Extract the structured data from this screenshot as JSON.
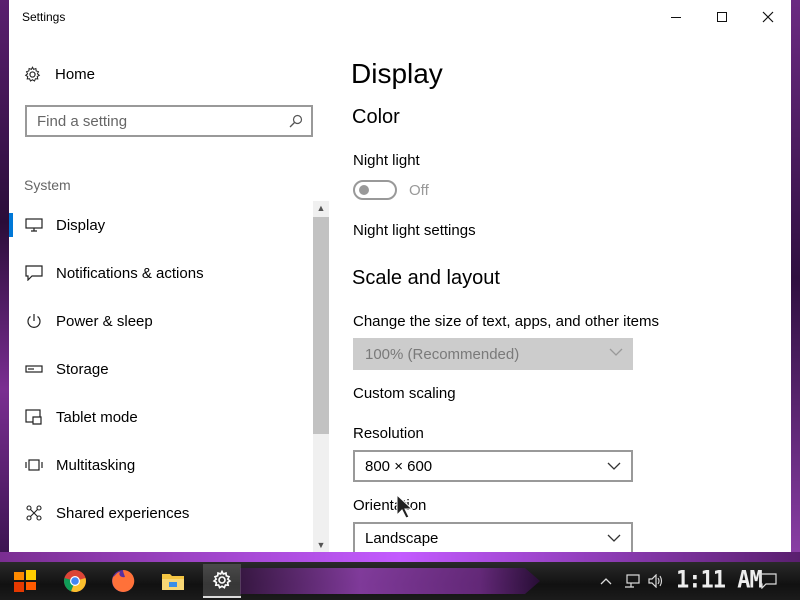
{
  "window": {
    "title": "Settings"
  },
  "sidebar": {
    "home_label": "Home",
    "search_placeholder": "Find a setting",
    "section_label": "System",
    "items": [
      {
        "label": "Display",
        "icon": "monitor-icon",
        "active": true
      },
      {
        "label": "Notifications & actions",
        "icon": "notification-icon",
        "active": false
      },
      {
        "label": "Power & sleep",
        "icon": "power-icon",
        "active": false
      },
      {
        "label": "Storage",
        "icon": "storage-icon",
        "active": false
      },
      {
        "label": "Tablet mode",
        "icon": "tablet-icon",
        "active": false
      },
      {
        "label": "Multitasking",
        "icon": "multitasking-icon",
        "active": false
      },
      {
        "label": "Shared experiences",
        "icon": "shared-icon",
        "active": false
      }
    ]
  },
  "main": {
    "page_title": "Display",
    "color_heading": "Color",
    "night_light_label": "Night light",
    "night_light_state": "Off",
    "night_light_settings_link": "Night light settings",
    "scale_heading": "Scale and layout",
    "scale_description": "Change the size of text, apps, and other items",
    "scale_value": "100% (Recommended)",
    "custom_scaling_link": "Custom scaling",
    "resolution_label": "Resolution",
    "resolution_value": "800 × 600",
    "orientation_label": "Orientation",
    "orientation_value": "Landscape"
  },
  "taskbar": {
    "clock": "1:11 AM",
    "apps": [
      "start-icon",
      "chrome-icon",
      "firefox-icon",
      "file-explorer-icon",
      "settings-gear-icon"
    ]
  },
  "colors": {
    "accent": "#0078d7",
    "disabled_dropdown": "#cccccc",
    "muted_text": "#999999"
  }
}
